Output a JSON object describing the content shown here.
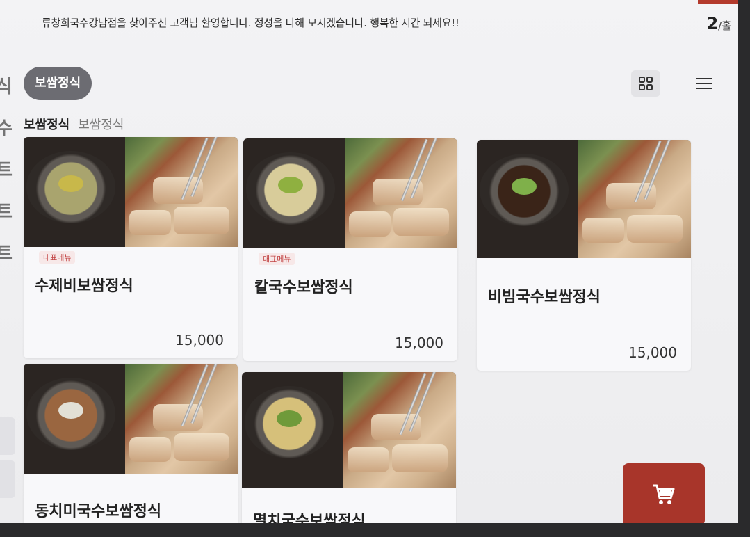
{
  "header": {
    "welcome_message": "류창희국수강남점을 찾아주신 고객님 환영합니다. 정성을 다해 모시겠습니다. 행복한 시간 되세요!!",
    "table_number": "2",
    "table_unit": "/홀"
  },
  "sidebar": {
    "fragments": [
      "식",
      "수",
      "트",
      "트",
      "트"
    ]
  },
  "category": {
    "selected": "보쌈정식"
  },
  "breadcrumb": {
    "main": "보쌈정식",
    "sub": "보쌈정식"
  },
  "menu_items": [
    {
      "name": "수제비보쌈정식",
      "price": "15,000",
      "badge": "대표메뉴"
    },
    {
      "name": "칼국수보쌈정식",
      "price": "15,000",
      "badge": "대표메뉴"
    },
    {
      "name": "비빔국수보쌈정식",
      "price": "15,000",
      "badge": ""
    },
    {
      "name": "동치미국수보쌈정식",
      "price": "",
      "badge": ""
    },
    {
      "name": "멸치국수보쌈정식",
      "price": "",
      "badge": ""
    }
  ],
  "icons": {
    "grid_view": "grid-icon",
    "list_view": "menu-icon",
    "cart": "cart-icon"
  },
  "colors": {
    "accent": "#a8352a",
    "category_pill": "#6c6c72",
    "badge_text": "#c24444"
  }
}
